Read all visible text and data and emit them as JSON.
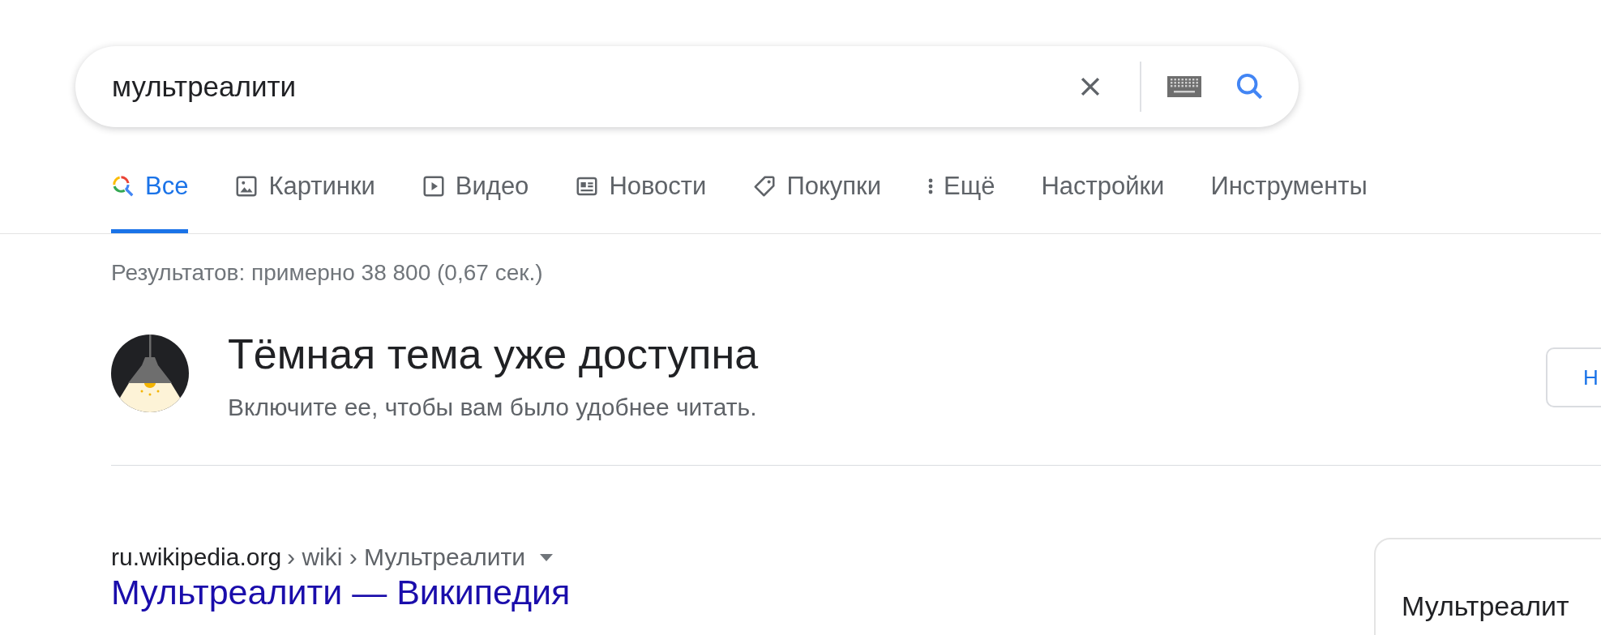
{
  "search": {
    "value": "мультреалити"
  },
  "tabs": [
    {
      "label": "Все",
      "kind": "search",
      "selected": true
    },
    {
      "label": "Картинки",
      "kind": "images",
      "selected": false
    },
    {
      "label": "Видео",
      "kind": "videos",
      "selected": false
    },
    {
      "label": "Новости",
      "kind": "news",
      "selected": false
    },
    {
      "label": "Покупки",
      "kind": "shopping",
      "selected": false
    },
    {
      "label": "Ещё",
      "kind": "more",
      "selected": false
    },
    {
      "label": "Настройки",
      "kind": "plain",
      "selected": false
    },
    {
      "label": "Инструменты",
      "kind": "plain",
      "selected": false
    }
  ],
  "result_stats": "Результатов: примерно 38 800 (0,67 сек.)",
  "promo": {
    "title": "Тёмная тема уже доступна",
    "text": "Включите ее, чтобы вам было удобнее читать.",
    "button": "Н"
  },
  "results": [
    {
      "site": "ru.wikipedia.org",
      "path": "› wiki › Мультреалити",
      "title": "Мультреалити — Википедия"
    }
  ],
  "knowledge_panel": {
    "title": "Мультреалит"
  }
}
